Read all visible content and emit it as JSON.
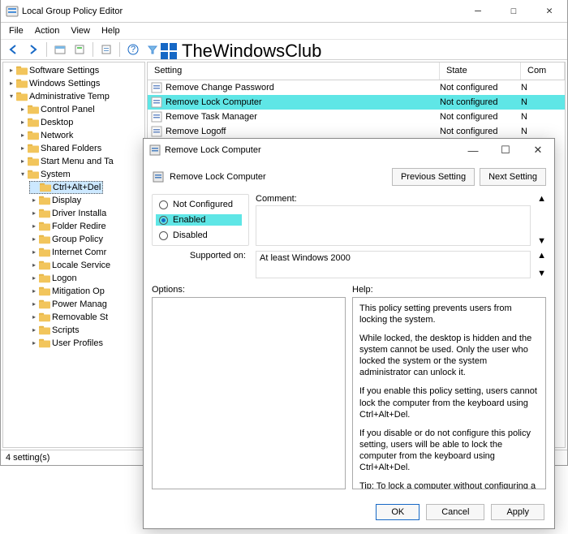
{
  "window": {
    "title": "Local Group Policy Editor",
    "menu": [
      "File",
      "Action",
      "View",
      "Help"
    ],
    "status": "4 setting(s)"
  },
  "watermark": {
    "text": "TheWindowsClub"
  },
  "tree": {
    "top": [
      {
        "label": "Software Settings",
        "exp": ">"
      },
      {
        "label": "Windows Settings",
        "exp": ">"
      }
    ],
    "admin_label": "Administrative Temp",
    "children": [
      "Control Panel",
      "Desktop",
      "Network",
      "Shared Folders",
      "Start Menu and Ta"
    ],
    "system_label": "System",
    "system_children": [
      "Ctrl+Alt+Del",
      "Display",
      "Driver Installa",
      "Folder Redire",
      "Group Policy",
      "Internet Comr",
      "Locale Service",
      "Logon",
      "Mitigation Op",
      "Power Manag",
      "Removable St",
      "Scripts",
      "User Profiles"
    ]
  },
  "list": {
    "headers": {
      "c1": "Setting",
      "c2": "State",
      "c3": "Com"
    },
    "rows": [
      {
        "name": "Remove Change Password",
        "state": "Not configured",
        "c": "N",
        "sel": false
      },
      {
        "name": "Remove Lock Computer",
        "state": "Not configured",
        "c": "N",
        "sel": true
      },
      {
        "name": "Remove Task Manager",
        "state": "Not configured",
        "c": "N",
        "sel": false
      },
      {
        "name": "Remove Logoff",
        "state": "Not configured",
        "c": "N",
        "sel": false
      }
    ]
  },
  "dialog": {
    "title": "Remove Lock Computer",
    "subtitle": "Remove Lock Computer",
    "prev": "Previous Setting",
    "next": "Next Setting",
    "radios": {
      "not": "Not Configured",
      "enabled": "Enabled",
      "disabled": "Disabled"
    },
    "comment_label": "Comment:",
    "supported_label": "Supported on:",
    "supported_value": "At least Windows 2000",
    "options_label": "Options:",
    "help_label": "Help:",
    "help_paras": [
      "This policy setting prevents users from locking the system.",
      "While locked, the desktop is hidden and the system cannot be used. Only the user who locked the system or the system administrator can unlock it.",
      "If you enable this policy setting, users cannot lock the computer from the keyboard using Ctrl+Alt+Del.",
      "If you disable or do not configure this policy setting, users will be able to lock the computer from the keyboard using Ctrl+Alt+Del.",
      "Tip: To lock a computer without configuring a setting, press Ctrl+Alt+Delete, and then click Lock this computer."
    ],
    "buttons": {
      "ok": "OK",
      "cancel": "Cancel",
      "apply": "Apply"
    }
  }
}
